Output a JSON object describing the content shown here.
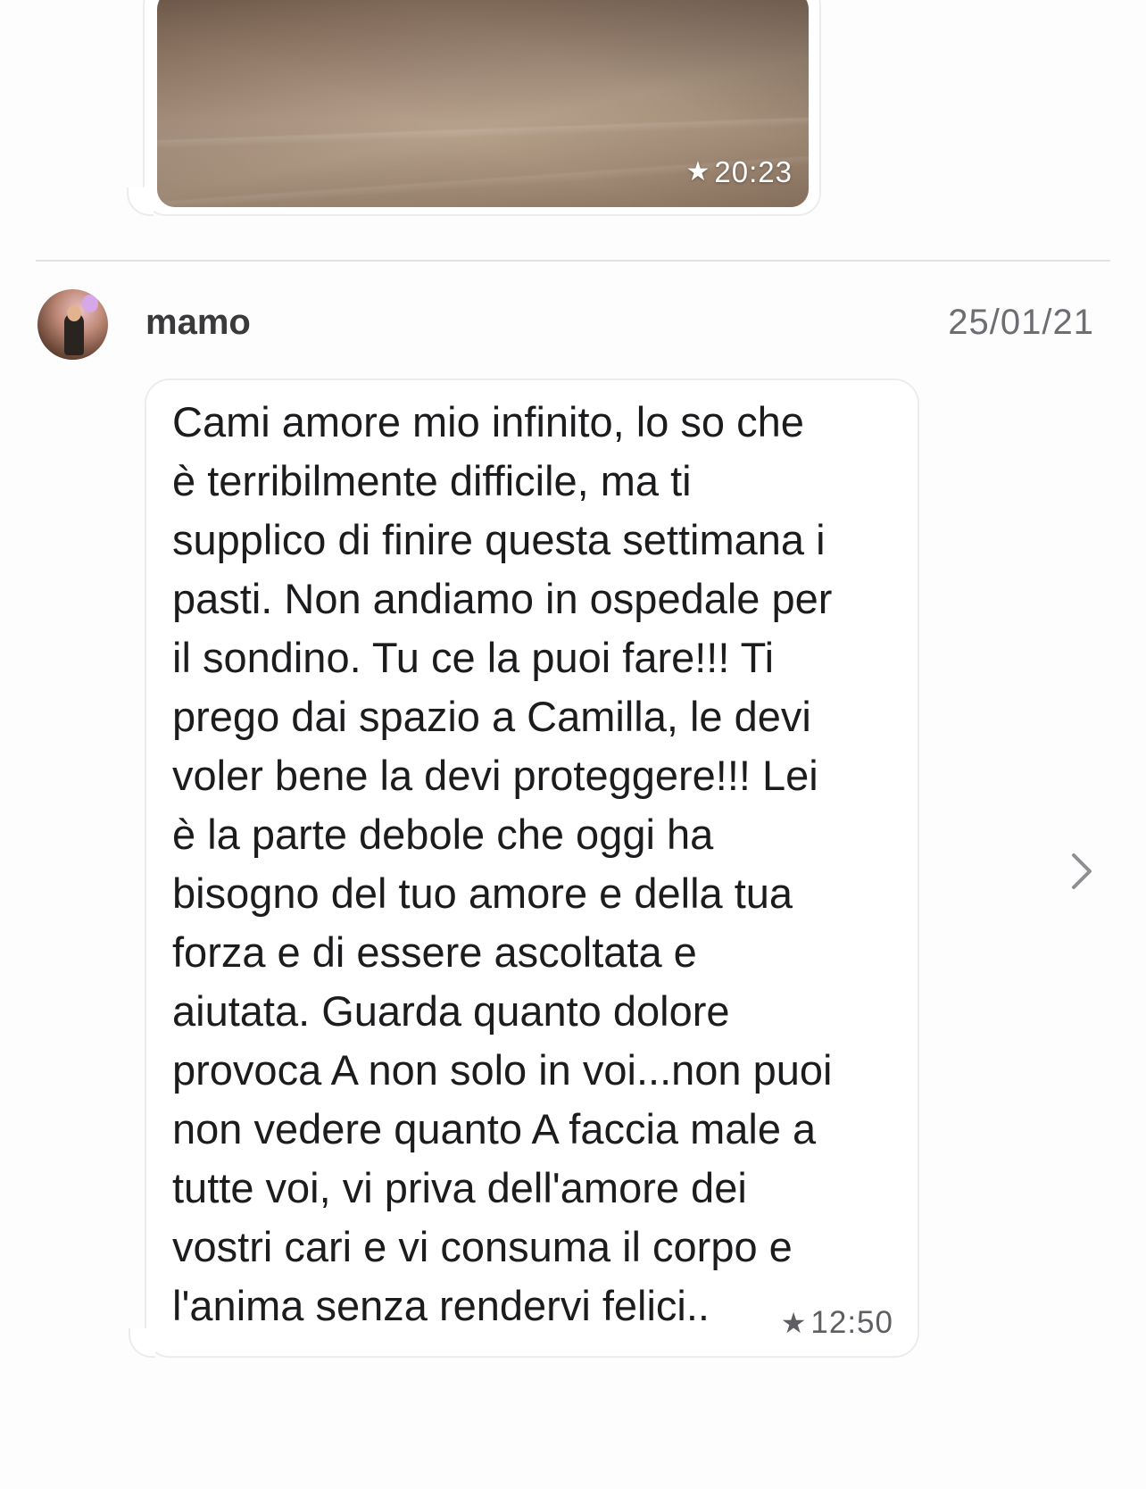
{
  "photo_message": {
    "time": "20:23",
    "star_icon": "star-icon"
  },
  "message": {
    "sender": "mamo",
    "date": "25/01/21",
    "text": "Cami amore mio infinito, lo so che\nè terribilmente difficile, ma ti\nsupplico di finire questa settimana i\npasti. Non andiamo in ospedale per\nil sondino.  Tu ce la puoi fare!!! Ti\nprego dai spazio a Camilla, le devi\nvoler bene la devi proteggere!!! Lei\nè la parte debole che oggi ha\nbisogno del tuo amore e della tua\nforza e di essere ascoltata e\naiutata. Guarda quanto dolore\nprovoca A non solo in voi...non puoi\nnon vedere quanto A faccia male a\ntutte voi, vi priva dell'amore dei\nvostri cari e vi consuma il corpo e\nl'anima senza rendervi felici..",
    "time": "12:50",
    "star_icon": "star-icon"
  },
  "icons": {
    "chevron": "chevron-right-icon",
    "avatar": "avatar"
  }
}
